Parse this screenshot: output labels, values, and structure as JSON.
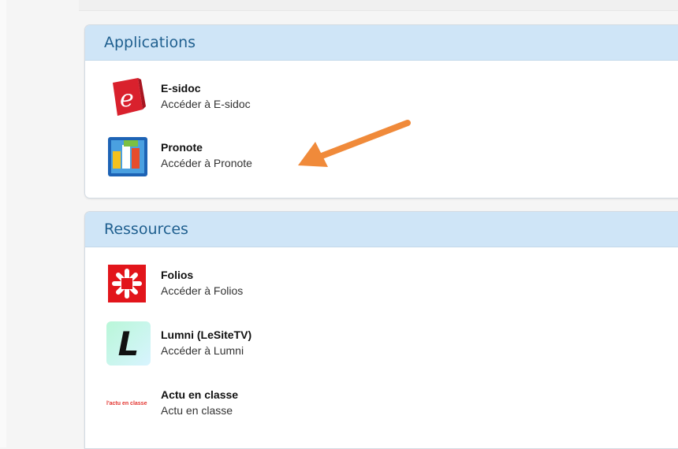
{
  "applications": {
    "title": "Applications",
    "items": [
      {
        "title": "E-sidoc",
        "description": "Accéder à E-sidoc",
        "icon": "esidoc-logo-icon"
      },
      {
        "title": "Pronote",
        "description": "Accéder à Pronote",
        "icon": "pronote-logo-icon"
      }
    ]
  },
  "resources": {
    "title": "Ressources",
    "items": [
      {
        "title": "Folios",
        "description": "Accéder à Folios",
        "icon": "folios-logo-icon"
      },
      {
        "title": "Lumni (LeSiteTV)",
        "description": "Accéder à Lumni",
        "icon": "lumni-logo-icon",
        "logo_text": "L"
      },
      {
        "title": "Actu en classe",
        "description": "Actu en classe",
        "icon": "actu-en-classe-logo-icon",
        "logo_text": "l'actu en classe"
      }
    ]
  },
  "annotation": {
    "icon": "orange-arrow-icon",
    "color": "#f08a3a"
  },
  "colors": {
    "header_bg": "#cfe5f7",
    "header_text": "#1f5f8f"
  }
}
